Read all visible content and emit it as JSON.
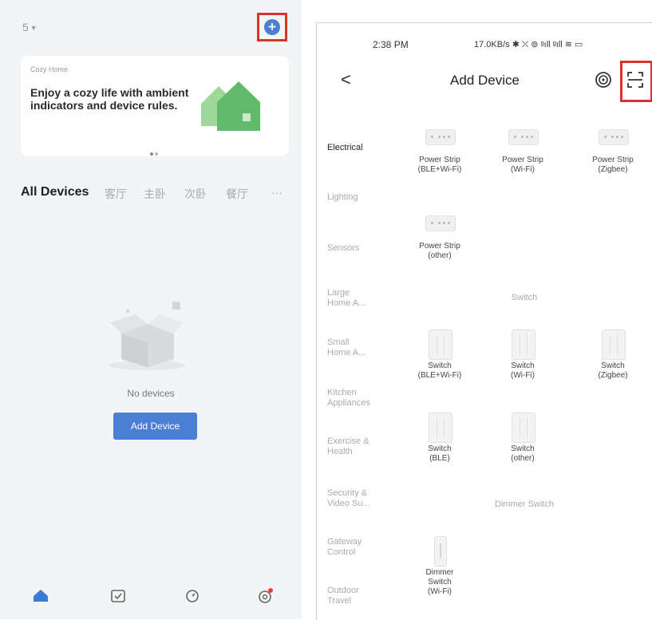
{
  "left": {
    "home_selector": "5",
    "banner": {
      "kicker": "Cozy Home",
      "headline": "Enjoy a cozy life with ambient indicators and device rules."
    },
    "tabs": [
      "All Devices",
      "客厅",
      "主卧",
      "次卧",
      "餐厅",
      "···"
    ],
    "empty_text": "No devices",
    "add_device_button": "Add Device",
    "bottom_nav": [
      "home-icon",
      "scene-icon",
      "smart-icon",
      "me-icon"
    ]
  },
  "right": {
    "status": {
      "time": "2:38 PM",
      "indicators": "17.0KB/s ✱ ⛌ ⊚ ᵍıll ᵍıll ≋ ▭"
    },
    "header": {
      "back": "<",
      "title": "Add Device"
    },
    "categories": [
      "Electrical",
      "Lighting",
      "Sensors",
      "Large\nHome A...",
      "Small\nHome A...",
      "Kitchen\nAppliances",
      "Exercise &\nHealth",
      "Security &\nVideo Su...",
      "Gateway\nControl",
      "Outdoor\nTravel"
    ],
    "power_strips": [
      "Power Strip\n(BLE+Wi-Fi)",
      "Power Strip\n(Wi-Fi)",
      "Power Strip\n(Zigbee)",
      "Power Strip\n(other)"
    ],
    "section_switch": "Switch",
    "switches": [
      "Switch\n(BLE+Wi-Fi)",
      "Switch\n(Wi-Fi)",
      "Switch\n(Zigbee)",
      "Switch\n(BLE)",
      "Switch\n(other)"
    ],
    "section_dimmer": "Dimmer Switch",
    "dimmers": [
      "Dimmer\nSwitch\n(Wi-Fi)"
    ]
  }
}
